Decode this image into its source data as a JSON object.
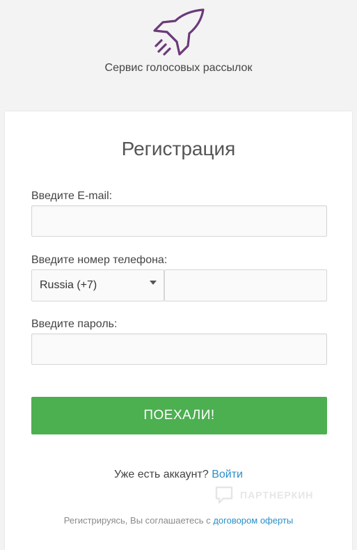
{
  "header": {
    "logo_icon": "rocket-icon",
    "logo_color": "#6b3a7a",
    "tagline": "Сервис голосовых рассылок"
  },
  "form": {
    "title": "Регистрация",
    "email": {
      "label": "Введите E-mail:",
      "value": "",
      "placeholder": ""
    },
    "phone": {
      "label": "Введите номер телефона:",
      "country_selected": "Russia (+7)",
      "value": "",
      "placeholder": ""
    },
    "password": {
      "label": "Введите пароль:",
      "value": "",
      "placeholder": ""
    },
    "submit_label": "ПОЕХАЛИ!",
    "submit_color": "#4caf50"
  },
  "footer": {
    "has_account_text": "Уже есть аккаунт?",
    "login_link": "Войти",
    "terms_prefix": "Регистрируясь, Вы соглашаетесь с",
    "terms_link": "договором оферты",
    "link_color": "#2a8fc9"
  },
  "watermark": {
    "text": "ПАРТНЕРКИН"
  }
}
